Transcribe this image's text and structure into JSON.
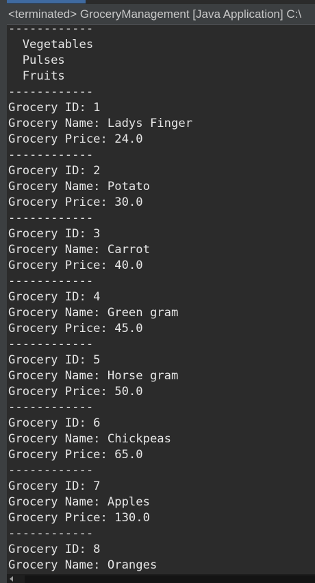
{
  "window": {
    "title": "<terminated> GroceryManagement [Java Application] C:\\"
  },
  "console": {
    "lines": [
      "------------",
      "  Vegetables",
      "  Pulses",
      "  Fruits",
      "------------",
      "Grocery ID: 1",
      "Grocery Name: Ladys Finger",
      "Grocery Price: 24.0",
      "------------",
      "Grocery ID: 2",
      "Grocery Name: Potato",
      "Grocery Price: 30.0",
      "------------",
      "Grocery ID: 3",
      "Grocery Name: Carrot",
      "Grocery Price: 40.0",
      "------------",
      "Grocery ID: 4",
      "Grocery Name: Green gram",
      "Grocery Price: 45.0",
      "------------",
      "Grocery ID: 5",
      "Grocery Name: Horse gram",
      "Grocery Price: 50.0",
      "------------",
      "Grocery ID: 6",
      "Grocery Name: Chickpeas",
      "Grocery Price: 65.0",
      "------------",
      "Grocery ID: 7",
      "Grocery Name: Apples",
      "Grocery Price: 130.0",
      "------------",
      "Grocery ID: 8",
      "Grocery Name: Oranges"
    ]
  },
  "icons": {
    "scroll_left": "chevron-left-icon"
  },
  "colors": {
    "background": "#2b2b2b",
    "text": "#e6e6e6",
    "header_bg": "#3c3f41",
    "tab_accent": "#3f6aa0"
  }
}
